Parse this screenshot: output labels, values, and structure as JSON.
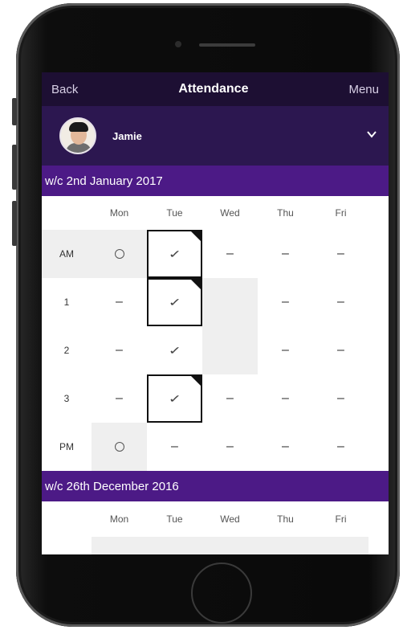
{
  "navbar": {
    "back_label": "Back",
    "title": "Attendance",
    "menu_label": "Menu"
  },
  "user": {
    "name": "Jamie"
  },
  "weeks": [
    {
      "header": "w/c 2nd January 2017",
      "days": [
        "Mon",
        "Tue",
        "Wed",
        "Thu",
        "Fri"
      ],
      "rows": [
        {
          "label": "AM",
          "cells": [
            "circle",
            "tick",
            "dash",
            "dash",
            "dash"
          ]
        },
        {
          "label": "1",
          "cells": [
            "dash",
            "tick",
            "empty",
            "dash",
            "dash"
          ]
        },
        {
          "label": "2",
          "cells": [
            "dash",
            "tick",
            "empty",
            "dash",
            "dash"
          ]
        },
        {
          "label": "3",
          "cells": [
            "dash",
            "tick",
            "dash",
            "dash",
            "dash"
          ]
        },
        {
          "label": "PM",
          "cells": [
            "circle",
            "dash",
            "dash",
            "dash",
            "dash"
          ]
        }
      ]
    },
    {
      "header": "w/c 26th December 2016",
      "days": [
        "Mon",
        "Tue",
        "Wed",
        "Thu",
        "Fri"
      ]
    }
  ],
  "colors": {
    "nav": "#1d0f33",
    "user_bar": "#2c1750",
    "week_header": "#4c1a86"
  },
  "icons": {
    "expand": "chevron-down-icon",
    "present": "tick-icon",
    "absent_code": "circle-icon"
  }
}
